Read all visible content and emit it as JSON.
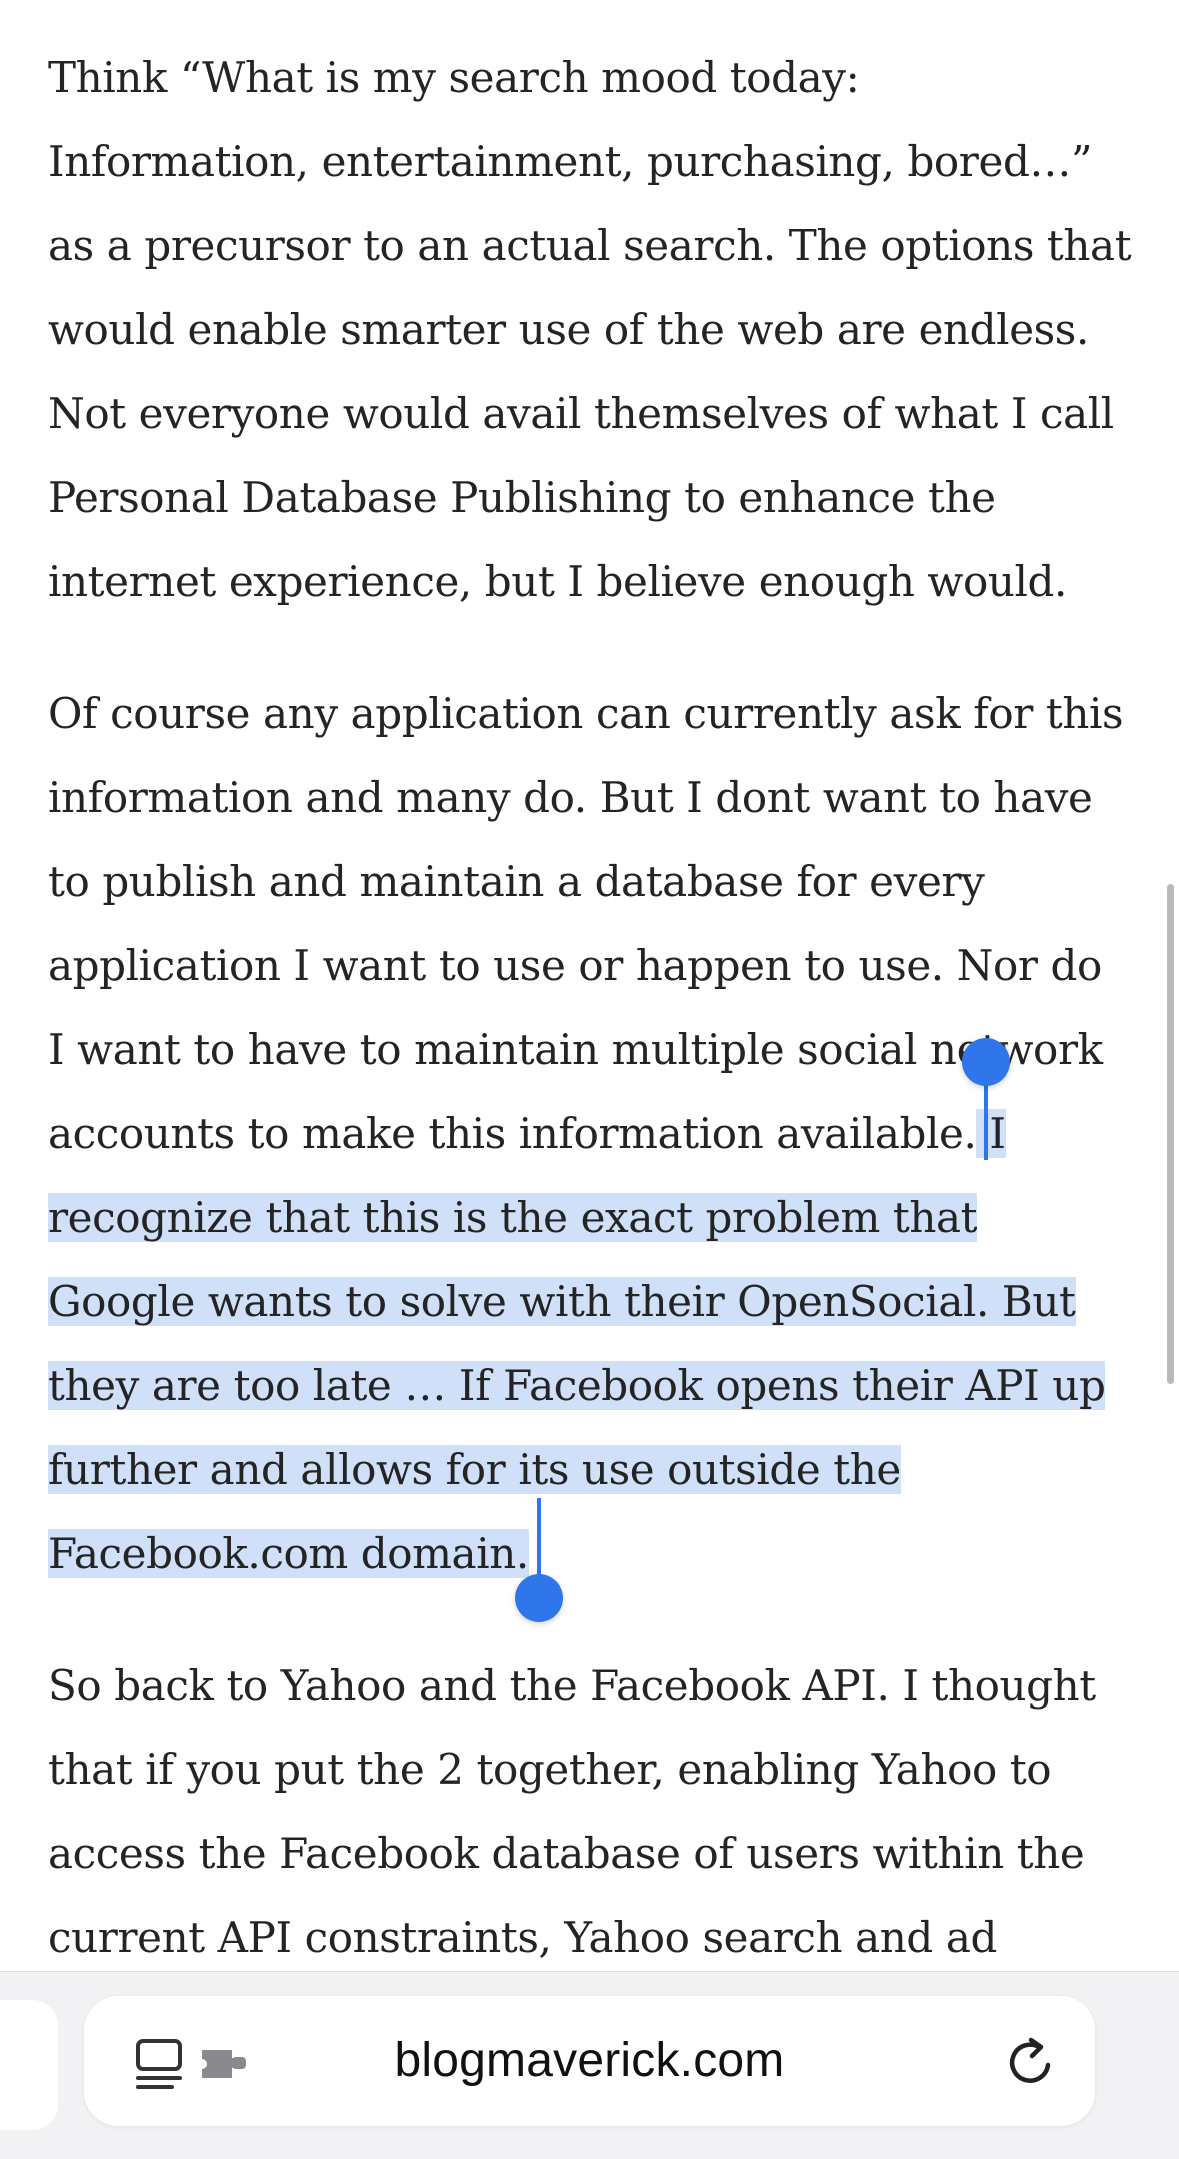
{
  "article": {
    "paragraph_1": "Think “What is my search mood today:\nInformation, entertainment, purchasing, bored…”\nas a precursor to an actual search. The options that\nwould enable smarter use of the web are endless.\nNot everyone would avail themselves of what I call\nPersonal Database Publishing to enhance the\ninternet experience, but I believe enough would.",
    "paragraph_2_before": "Of course any application can currently ask for this\ninformation and many do. But I dont want to have\nto publish and maintain a database for every\napplication I want to use or happen to use. Nor do\nI want to have to maintain multiple social network\naccounts to make this information available.",
    "paragraph_2_selected": " I\nrecognize that this is the exact problem that\nGoogle wants to solve with their OpenSocial. But\nthey are too late … If Facebook opens their API up\nfurther and allows for its use outside the\nFacebook.com domain.",
    "paragraph_3": "So back to Yahoo and the Facebook API. I thought\nthat if you put the 2 together, enabling Yahoo to\naccess the Facebook database of users within the\ncurrent API constraints, Yahoo search and ad"
  },
  "selection": {
    "color": "#cfe0f8",
    "handle_color": "#2f76ea"
  },
  "toolbar": {
    "url": "blogmaverick.com",
    "icons": [
      "reader-mode-icon",
      "extensions-icon",
      "reload-icon"
    ]
  }
}
